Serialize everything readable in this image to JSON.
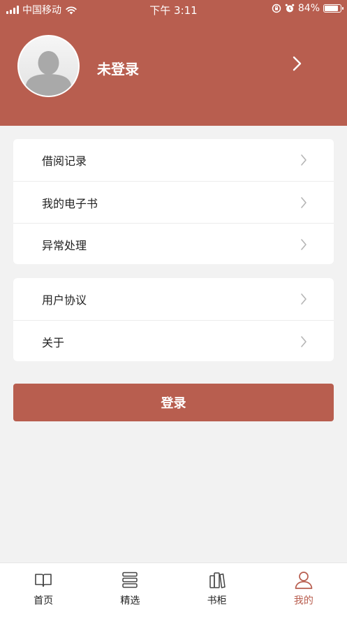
{
  "status_bar": {
    "carrier": "中国移动",
    "time": "下午 3:11",
    "battery": "84%"
  },
  "profile": {
    "name": "未登录",
    "avatar_icon": "user-placeholder-icon"
  },
  "menu_groups": [
    {
      "items": [
        "借阅记录",
        "我的电子书",
        "异常处理"
      ]
    },
    {
      "items": [
        "用户协议",
        "关于"
      ]
    }
  ],
  "login_button": "登录",
  "tabs": [
    {
      "label": "首页",
      "icon": "book-open-icon",
      "active": false
    },
    {
      "label": "精选",
      "icon": "stack-icon",
      "active": false
    },
    {
      "label": "书柜",
      "icon": "bookshelf-icon",
      "active": false
    },
    {
      "label": "我的",
      "icon": "person-icon",
      "active": true
    }
  ],
  "colors": {
    "accent": "#b85e4f",
    "background": "#f2f2f2"
  }
}
